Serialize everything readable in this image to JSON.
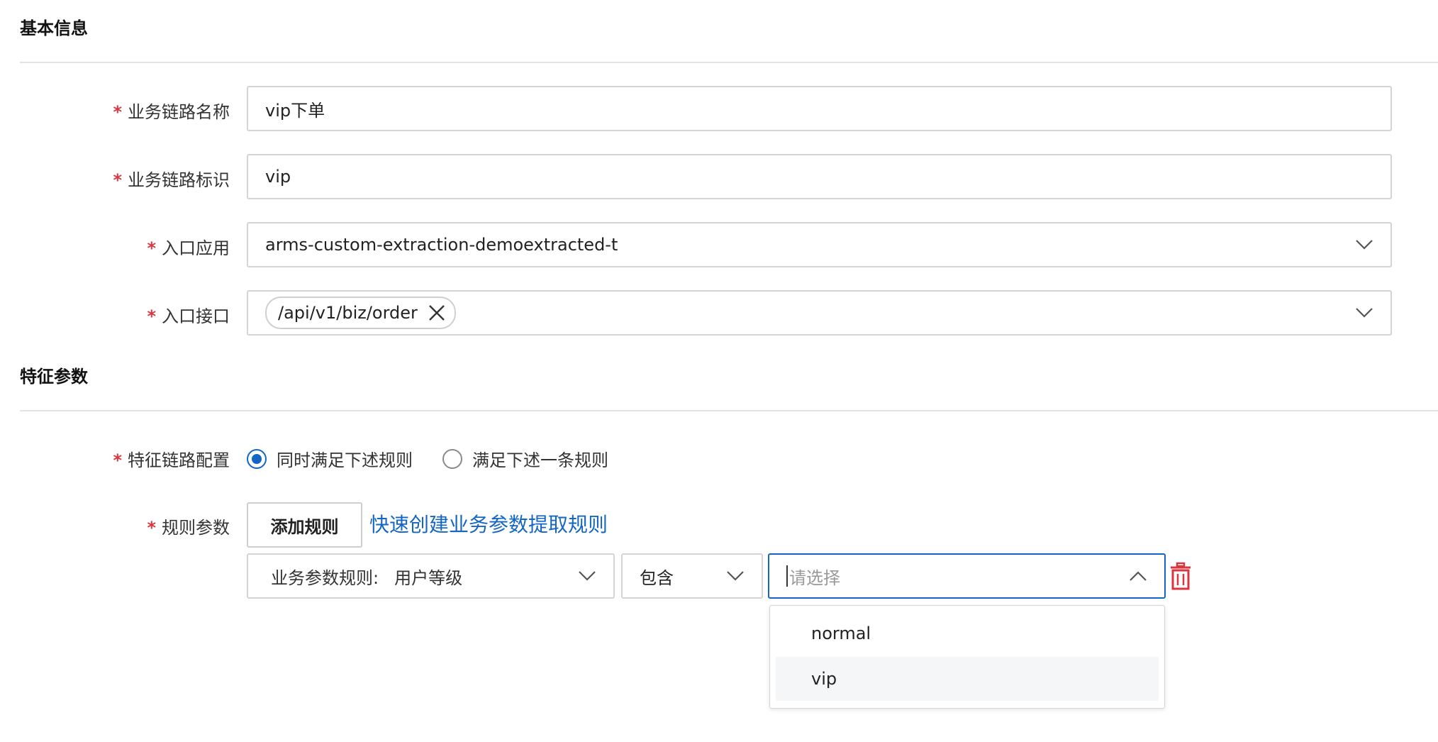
{
  "sections": {
    "basic_info": "基本信息",
    "feature_params": "特征参数"
  },
  "basic": {
    "chain_name": {
      "label": "业务链路名称",
      "value": "vip下单",
      "required_mark": "*"
    },
    "chain_id": {
      "label": "业务链路标识",
      "value": "vip",
      "required_mark": "*"
    },
    "entry_app": {
      "label": "入口应用",
      "value": "arms-custom-extraction-demoextracted-t",
      "required_mark": "*",
      "icon": "chevron-down-icon"
    },
    "entry_api": {
      "label": "入口接口",
      "tag": "/api/v1/biz/order",
      "required_mark": "*",
      "icon": "chevron-down-icon"
    }
  },
  "feature": {
    "chain_config": {
      "label": "特征链路配置",
      "required_mark": "*",
      "options": [
        {
          "label": "同时满足下述规则",
          "checked": true
        },
        {
          "label": "满足下述一条规则",
          "checked": false
        }
      ]
    },
    "rule_params": {
      "label": "规则参数",
      "required_mark": "*",
      "add_button": "添加规则",
      "quick_link": "快速创建业务参数提取规则"
    },
    "rule_row": {
      "rule_prefix": "业务参数规则:",
      "rule_value": "用户等级",
      "operator": "包含",
      "value_placeholder": "请选择",
      "dropdown_options": [
        "normal",
        "vip"
      ],
      "hovered_option": "vip"
    }
  },
  "colors": {
    "accent": "#1366c4",
    "required": "#d9363e",
    "delete": "#d9363e"
  }
}
